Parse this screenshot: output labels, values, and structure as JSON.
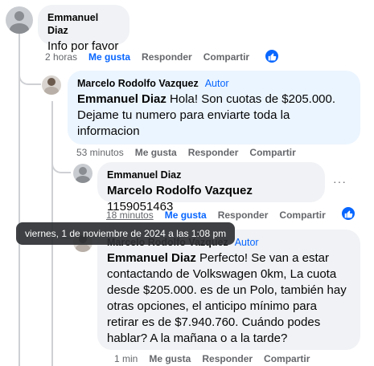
{
  "comments": [
    {
      "author": "Emmanuel Diaz",
      "text": "Info por favor",
      "time": "2 horas",
      "like_label": "Me gusta",
      "reply_label": "Responder",
      "share_label": "Compartir"
    },
    {
      "author": "Marcelo Rodolfo Vazquez",
      "author_badge": "Autor",
      "mention": "Emmanuel Diaz",
      "text": "Hola! Son cuotas de $205.000. Dejame tu numero para enviarte toda la informacion",
      "time": "53 minutos",
      "like_label": "Me gusta",
      "reply_label": "Responder",
      "share_label": "Compartir"
    },
    {
      "author": "Emmanuel Diaz",
      "mention": "Marcelo Rodolfo Vazquez",
      "text": "1159051463",
      "time": "18 minutos",
      "like_label": "Me gusta",
      "reply_label": "Responder",
      "share_label": "Compartir",
      "more": "···"
    },
    {
      "author": "Marcelo Rodolfo Vazquez",
      "author_badge": "Autor",
      "mention": "Emmanuel Diaz",
      "text": "Perfecto! Se van a estar contactando de Volkswagen 0km, La cuota desde $205.000. es de un Polo, también hay otras opciones, el anticipo mínimo para retirar es de $7.940.760. Cuándo podes hablar? A la mañana o a la tarde?",
      "time": "1 min",
      "like_label": "Me gusta",
      "reply_label": "Responder",
      "share_label": "Compartir"
    }
  ],
  "tooltip": "viernes, 1 de noviembre de 2024 a las 1:08 pm",
  "colors": {
    "accent": "#0866ff",
    "bubble": "#f0f2f5",
    "bubble_highlight": "#ebf5ff",
    "muted": "#65676b"
  }
}
